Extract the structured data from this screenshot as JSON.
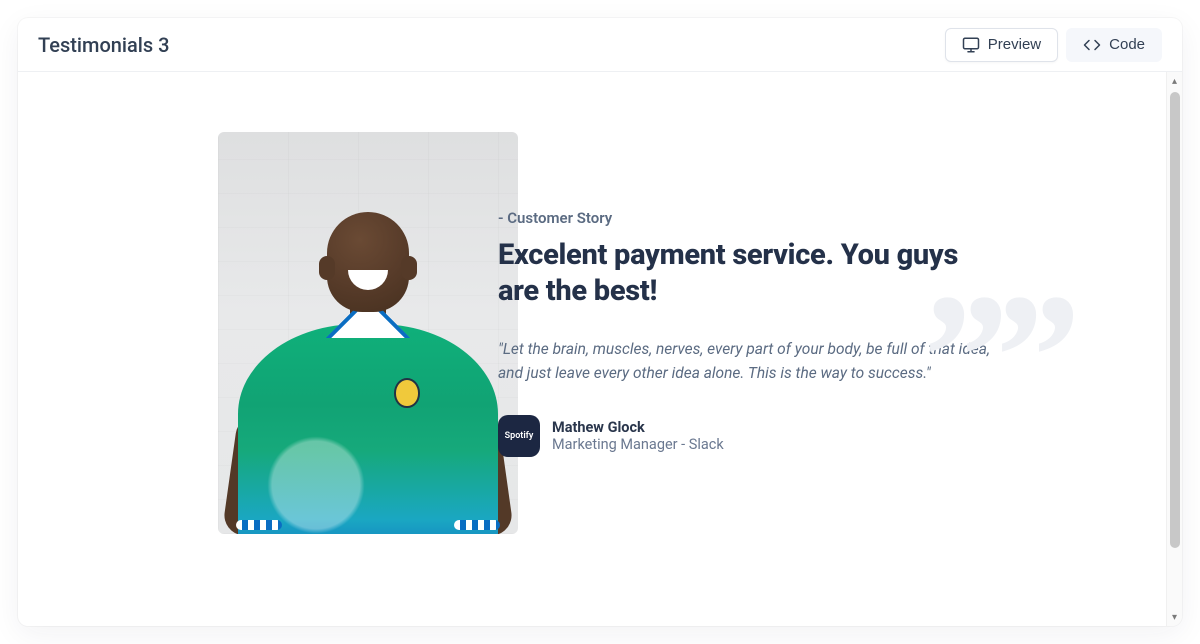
{
  "header": {
    "title": "Testimonials 3",
    "preview_label": "Preview",
    "code_label": "Code",
    "active_tab": "preview"
  },
  "testimonial": {
    "eyebrow": "- Customer Story",
    "headline": "Excelent payment service. You guys are the best!",
    "quote": "\"Let the brain, muscles, nerves, every part of your body, be full of that idea, and just leave every other idea alone. This is the way to success.\"",
    "author_name": "Mathew Glock",
    "author_role": "Marketing Manager - Slack",
    "avatar_label": "Spotify"
  },
  "icons": {
    "monitor": "monitor-icon",
    "code": "code-icon"
  }
}
